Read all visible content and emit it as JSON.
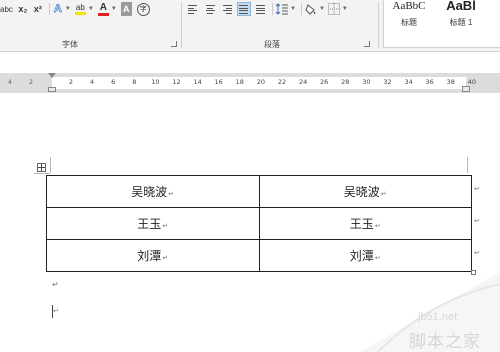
{
  "ribbon": {
    "font_group": {
      "label": "字体",
      "buttons": [
        {
          "name": "clear-format-button",
          "text": "abc"
        },
        {
          "name": "subscript-button",
          "text": "x₂"
        },
        {
          "name": "superscript-button",
          "text": "x²"
        },
        {
          "name": "text-effects-button",
          "text": "A"
        },
        {
          "name": "highlight-button",
          "text": "ab"
        },
        {
          "name": "font-color-button",
          "text": "A"
        },
        {
          "name": "char-shading-button",
          "text": "A"
        },
        {
          "name": "enclose-char-button",
          "text": "字"
        }
      ]
    },
    "paragraph_group": {
      "label": "段落"
    },
    "styles": {
      "items": [
        {
          "sample": "AaBbC",
          "name": "标题"
        },
        {
          "sample": "AaBl",
          "name": "标题 1"
        }
      ]
    }
  },
  "ruler": {
    "left_ticks": [
      "4",
      "2"
    ],
    "ticks": [
      "2",
      "4",
      "6",
      "8",
      "10",
      "12",
      "14",
      "16",
      "18",
      "20",
      "22",
      "24",
      "26",
      "28",
      "30",
      "32",
      "34",
      "36",
      "38",
      "40"
    ]
  },
  "table": {
    "rows": [
      [
        "吴晓波",
        "吴晓波"
      ],
      [
        "王玉",
        "王玉"
      ],
      [
        "刘潭",
        "刘潭"
      ]
    ],
    "cell_mark": "↵"
  },
  "watermark": {
    "domain": "jb51.net",
    "text": "脚本之家"
  }
}
